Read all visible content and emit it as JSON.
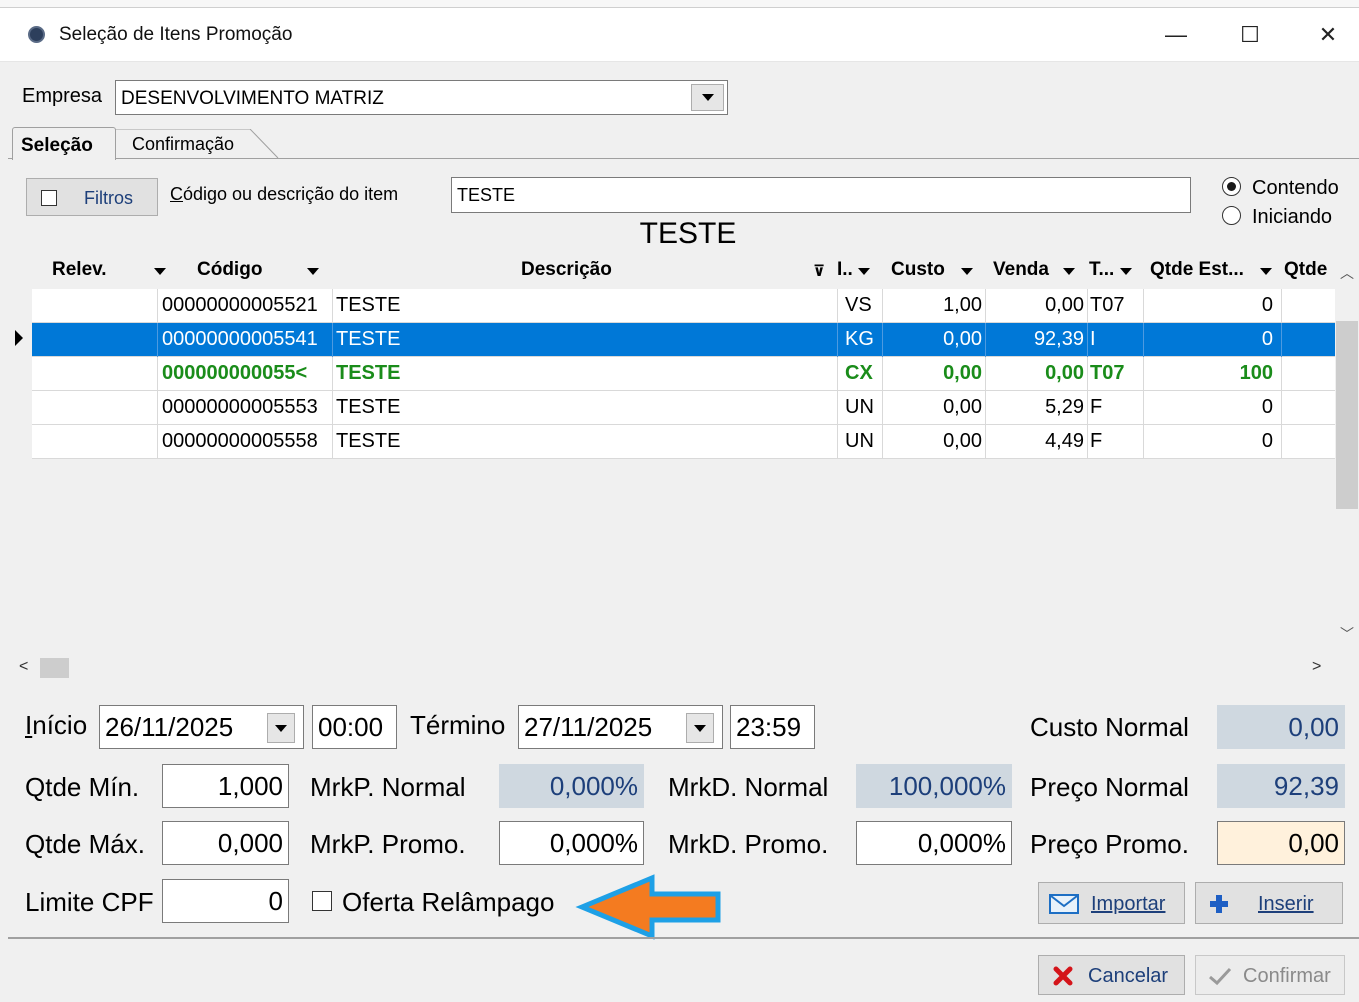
{
  "window": {
    "title": "Seleção de Itens Promoção",
    "min_glyph": "—",
    "max_glyph": "☐",
    "close_glyph": "✕"
  },
  "empresa": {
    "label": "Empresa",
    "value": "DESENVOLVIMENTO MATRIZ"
  },
  "tabs": [
    {
      "label": "Seleção",
      "active": true
    },
    {
      "label": "Confirmação",
      "active": false
    }
  ],
  "filter": {
    "filtros_label": "Filtros",
    "search_label": "Código ou descrição do item",
    "search_value": "TESTE",
    "radio_contendo": "Contendo",
    "radio_iniciando": "Iniciando",
    "selected_radio": "Contendo"
  },
  "grid": {
    "title": "TESTE",
    "columns": [
      "Relev.",
      "Código",
      "Descrição",
      "I..",
      "Custo",
      "Venda",
      "T...",
      "Qtde Est...",
      "Qtde"
    ],
    "rows": [
      {
        "relev": "",
        "codigo": "00000000005521",
        "descricao": "TESTE",
        "un": "VS",
        "custo": "1,00",
        "venda": "0,00",
        "t": "T07",
        "qtde_est": "0",
        "qtde": ""
      },
      {
        "relev": "",
        "codigo": "00000000005541",
        "descricao": "TESTE",
        "un": "KG",
        "custo": "0,00",
        "venda": "92,39",
        "t": "I",
        "qtde_est": "0",
        "qtde": ""
      },
      {
        "relev": "",
        "codigo": "000000000055<",
        "descricao": "TESTE",
        "un": "CX",
        "custo": "0,00",
        "venda": "0,00",
        "t": "T07",
        "qtde_est": "100",
        "qtde": ""
      },
      {
        "relev": "",
        "codigo": "00000000005553",
        "descricao": "TESTE",
        "un": "UN",
        "custo": "0,00",
        "venda": "5,29",
        "t": "F",
        "qtde_est": "0",
        "qtde": ""
      },
      {
        "relev": "",
        "codigo": "00000000005558",
        "descricao": "TESTE",
        "un": "UN",
        "custo": "0,00",
        "venda": "4,49",
        "t": "F",
        "qtde_est": "0",
        "qtde": ""
      }
    ]
  },
  "form": {
    "inicio_label": "Início",
    "inicio_date": "26/11/2025",
    "inicio_time": "00:00",
    "termino_label": "Término",
    "termino_date": "27/11/2025",
    "termino_time": "23:59",
    "custo_normal_label": "Custo Normal",
    "custo_normal_value": "0,00",
    "qtde_min_label": "Qtde Mín.",
    "qtde_min_value": "1,000",
    "mrkp_normal_label": "MrkP. Normal",
    "mrkp_normal_value": "0,000%",
    "mrkd_normal_label": "MrkD. Normal",
    "mrkd_normal_value": "100,000%",
    "preco_normal_label": "Preço Normal",
    "preco_normal_value": "92,39",
    "qtde_max_label": "Qtde Máx.",
    "qtde_max_value": "0,000",
    "mrkp_promo_label": "MrkP. Promo.",
    "mrkp_promo_value": "0,000%",
    "mrkd_promo_label": "MrkD. Promo.",
    "mrkd_promo_value": "0,000%",
    "preco_promo_label": "Preço Promo.",
    "preco_promo_value": "0,00",
    "limite_cpf_label": "Limite CPF",
    "limite_cpf_value": "0",
    "oferta_label": "Oferta Relâmpago"
  },
  "buttons": {
    "importar": "Importar",
    "inserir": "Inserir",
    "cancelar": "Cancelar",
    "confirmar": "Confirmar"
  },
  "colors": {
    "selection": "#0078d7",
    "green_row": "#1a8c1a",
    "arrow_fill": "#f47b20",
    "arrow_stroke": "#1ea0e6",
    "readonly_bg": "#cfd8e0",
    "promo_bg": "#fff1dc"
  },
  "icons": [
    "app-icon",
    "filter-icon",
    "importar-icon",
    "inserir-plus-icon",
    "cancelar-x-icon",
    "confirmar-check-icon",
    "arrow-annotation"
  ]
}
